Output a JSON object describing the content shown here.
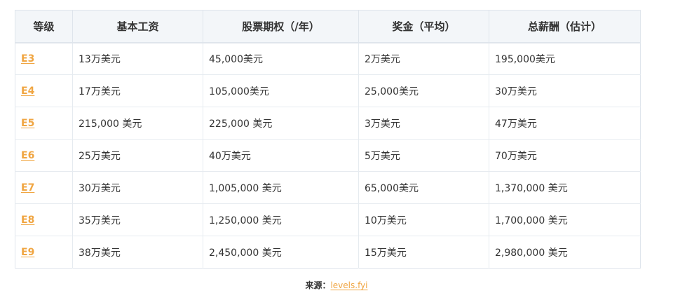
{
  "table": {
    "headers": [
      "等级",
      "基本工资",
      "股票期权（/年）",
      "奖金（平均）",
      "总薪酬（估计）"
    ],
    "rows": [
      [
        "E3",
        "13万美元",
        "45,000美元",
        "2万美元",
        "195,000美元"
      ],
      [
        "E4",
        "17万美元",
        "105,000美元",
        "25,000美元",
        "30万美元"
      ],
      [
        "E5",
        "215,000 美元",
        "225,000 美元",
        "3万美元",
        "47万美元"
      ],
      [
        "E6",
        "25万美元",
        "40万美元",
        "5万美元",
        "70万美元"
      ],
      [
        "E7",
        "30万美元",
        "1,005,000 美元",
        "65,000美元",
        "1,370,000 美元"
      ],
      [
        "E8",
        "35万美元",
        "1,250,000 美元",
        "10万美元",
        "1,700,000 美元"
      ],
      [
        "E9",
        "38万美元",
        "2,450,000 美元",
        "15万美元",
        "2,980,000 美元"
      ]
    ]
  },
  "source": {
    "label": "来源：",
    "link_text": "levels.fyi"
  },
  "colors": {
    "link": "#f0a541",
    "header_bg": "#f3f6f9",
    "border": "#dfe5ec",
    "text": "#333333"
  }
}
